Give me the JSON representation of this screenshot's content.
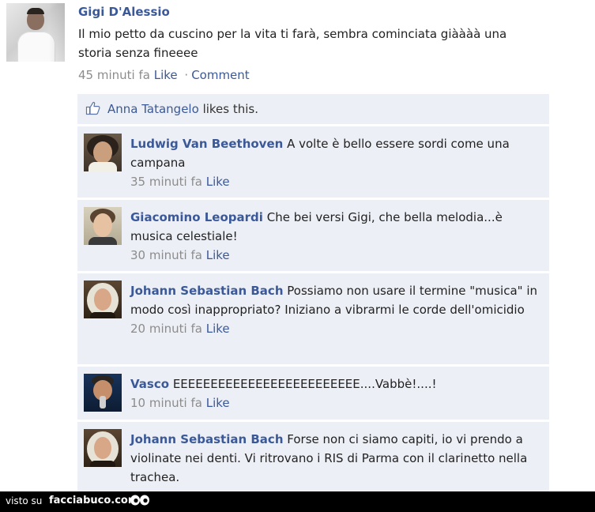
{
  "post": {
    "author": "Gigi D'Alessio",
    "text": "Il mio petto da cuscino per la vita ti farà, sembra cominciata giàààà una storia senza fineeee",
    "time": "45 minuti fa",
    "like_label": "Like",
    "separator": "·",
    "comment_label": "Comment"
  },
  "likes": {
    "icon": "thumbs-up-icon",
    "liker": "Anna Tatangelo",
    "suffix": "likes this."
  },
  "comments": [
    {
      "author": "Ludwig Van Beethoven",
      "text": "A volte è bello essere sordi come una campana",
      "time": "35 minuti fa",
      "like_label": "Like"
    },
    {
      "author": "Giacomino Leopardi",
      "text": "Che bei versi Gigi, che bella melodia...è musica celestiale!",
      "time": "30 minuti fa",
      "like_label": "Like"
    },
    {
      "author": "Johann Sebastian Bach",
      "text": "Possiamo non usare il termine \"musica\" in modo così inappropriato? Iniziano a vibrarmi le corde dell'omicidio",
      "time": "20 minuti fa",
      "like_label": "Like"
    },
    {
      "author": "Vasco",
      "text": "EEEEEEEEEEEEEEEEEEEEEEEEE....Vabbè!....!",
      "time": "10 minuti fa",
      "like_label": "Like"
    },
    {
      "author": "Johann Sebastian Bach",
      "text": "Forse non ci siamo capiti, io vi prendo a violinate nei denti. Vi ritrovano i RIS di Parma con il clarinetto nella trachea.",
      "time": "",
      "like_label": ""
    }
  ],
  "footer": {
    "prefix": "visto su",
    "site": "facciabuco.com",
    "icon": "eyes-icon"
  },
  "colors": {
    "link": "#3b5998",
    "comment_bg": "#eceff5",
    "meta_text": "#8c8c8c"
  }
}
